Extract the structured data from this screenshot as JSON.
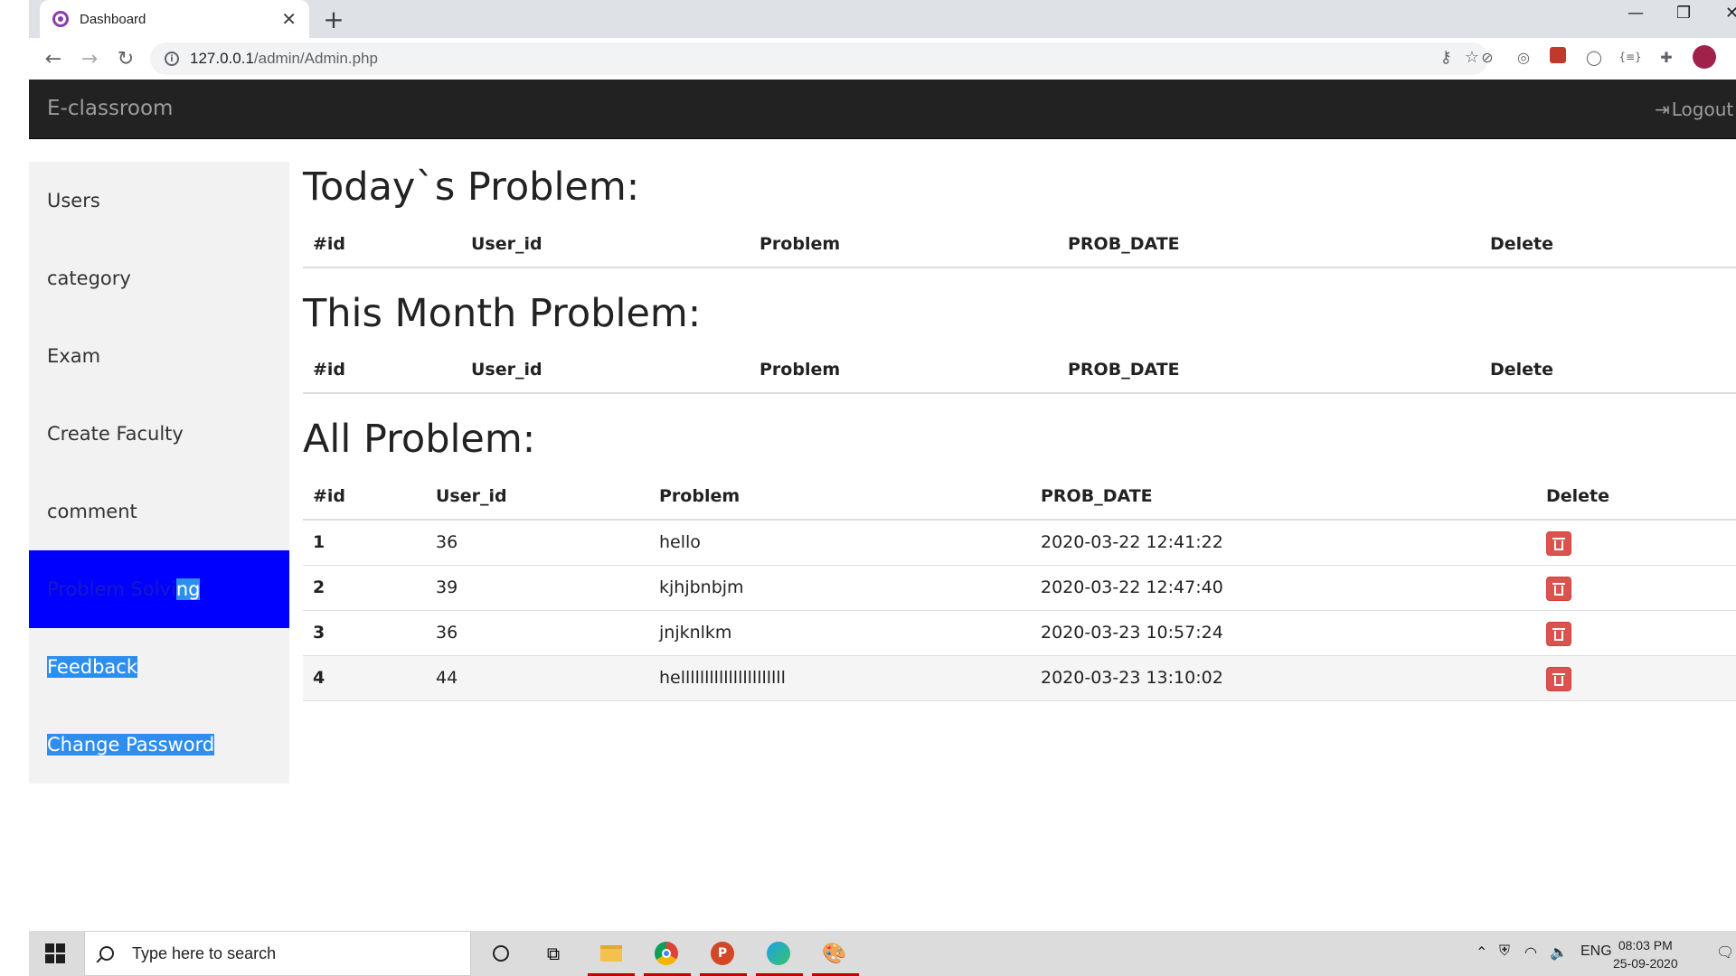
{
  "browser": {
    "tab_title": "Dashboard",
    "url_host": "127.0.0.1",
    "url_path": "/admin/Admin.php"
  },
  "navbar": {
    "brand": "E-classroom",
    "logout": "Logout"
  },
  "sidebar": {
    "items": [
      {
        "label": "Users"
      },
      {
        "label": "category"
      },
      {
        "label": "Exam"
      },
      {
        "label": "Create Faculty"
      },
      {
        "label": "comment"
      },
      {
        "label_a": "Problem Solvi",
        "label_b": "ng"
      },
      {
        "label": "Feedback"
      },
      {
        "label": "Change Password"
      }
    ]
  },
  "sections": {
    "today": {
      "title": "Today`s Problem:",
      "headers": [
        "#id",
        "User_id",
        "Problem",
        "PROB_DATE",
        "Delete"
      ]
    },
    "month": {
      "title": "This Month Problem:",
      "headers": [
        "#id",
        "User_id",
        "Problem",
        "PROB_DATE",
        "Delete"
      ]
    },
    "all": {
      "title": "All Problem:",
      "headers": [
        "#id",
        "User_id",
        "Problem",
        "PROB_DATE",
        "Delete"
      ],
      "rows": [
        {
          "id": "1",
          "user_id": "36",
          "problem": "hello",
          "date": "2020-03-22 12:41:22"
        },
        {
          "id": "2",
          "user_id": "39",
          "problem": "kjhjbnbjm",
          "date": "2020-03-22 12:47:40"
        },
        {
          "id": "3",
          "user_id": "36",
          "problem": "jnjknlkm",
          "date": "2020-03-23 10:57:24"
        },
        {
          "id": "4",
          "user_id": "44",
          "problem": "hellllllllllllllllllllll",
          "date": "2020-03-23 13:10:02"
        }
      ]
    }
  },
  "taskbar": {
    "search_placeholder": "Type here to search",
    "lang": "ENG",
    "time": "08:03 PM",
    "date": "25-09-2020"
  },
  "colors": {
    "navbar_bg": "#222222",
    "sidebar_active": "#0000ff",
    "delete_btn": "#d9534f",
    "selection": "#2e8ef0"
  }
}
